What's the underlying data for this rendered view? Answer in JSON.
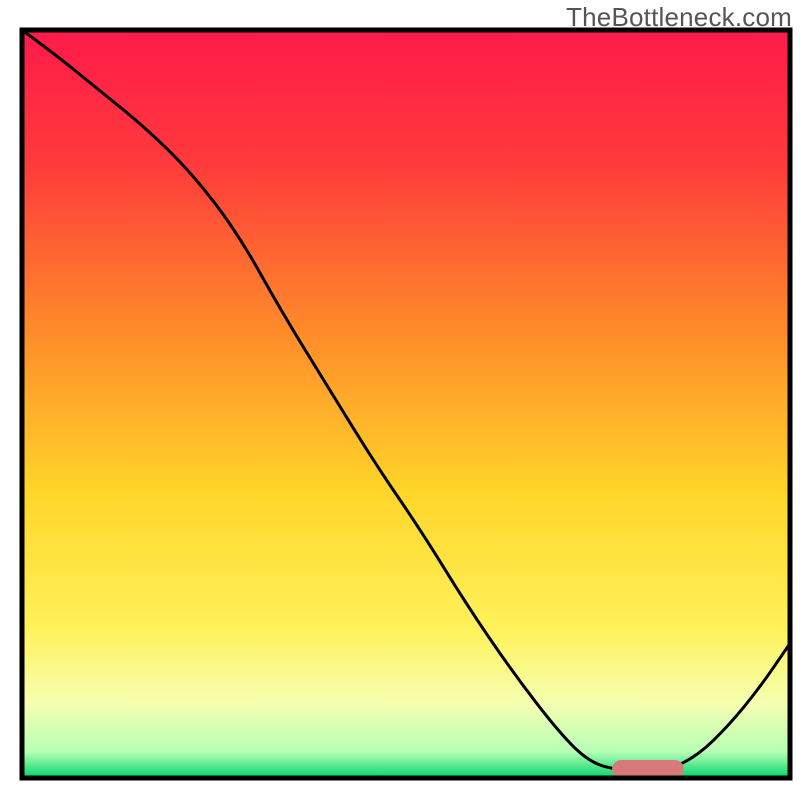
{
  "watermark": "TheBottleneck.com",
  "chart_data": {
    "type": "line",
    "title": "",
    "xlabel": "",
    "ylabel": "",
    "xlim": [
      0,
      100
    ],
    "ylim": [
      0,
      100
    ],
    "gradient_stops": [
      {
        "offset": 0.0,
        "color": "#ff1a4a"
      },
      {
        "offset": 0.18,
        "color": "#ff3b3b"
      },
      {
        "offset": 0.4,
        "color": "#ff8a2a"
      },
      {
        "offset": 0.62,
        "color": "#ffd62a"
      },
      {
        "offset": 0.8,
        "color": "#fff25a"
      },
      {
        "offset": 0.9,
        "color": "#f6ffb0"
      },
      {
        "offset": 0.965,
        "color": "#b6ffb6"
      },
      {
        "offset": 1.0,
        "color": "#00d46a"
      }
    ],
    "series": [
      {
        "name": "bottleneck-curve",
        "x": [
          0,
          4,
          10,
          16,
          22,
          28,
          34,
          40,
          46,
          52,
          58,
          64,
          70,
          74,
          78,
          81,
          84,
          88,
          92,
          96,
          100
        ],
        "y": [
          100,
          97,
          92,
          87,
          81,
          73,
          62,
          52,
          42,
          33,
          23,
          14,
          6,
          2,
          1,
          1,
          1,
          3,
          7,
          12,
          18
        ]
      }
    ],
    "marker": {
      "name": "optimal-range",
      "x_start": 78,
      "x_end": 85,
      "y": 1.2,
      "color": "#d97a7a",
      "thickness": 2.4
    },
    "frame": {
      "color": "#000000",
      "width": 5
    }
  }
}
